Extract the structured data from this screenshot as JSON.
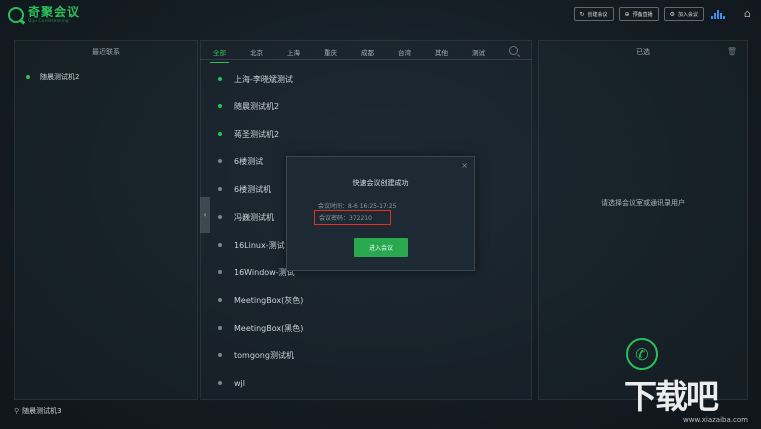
{
  "app": {
    "logo_title": "奇聚会议",
    "logo_subtitle": "Qiju Conferencing"
  },
  "toolbar": {
    "create_meeting": "创建会议",
    "schedule_live": "预备直播",
    "join_meeting": "加入会议"
  },
  "left_panel": {
    "title": "最近联系",
    "items": [
      {
        "name": "随晨测试机2",
        "status": "online"
      }
    ],
    "current_user": "随晨测试机3"
  },
  "middle_panel": {
    "tabs": [
      "全部",
      "北京",
      "上海",
      "重庆",
      "成都",
      "台湾",
      "其他",
      "测试"
    ],
    "active_tab": "全部",
    "contacts": [
      {
        "name": "上海-李晓斌测试",
        "status": "online"
      },
      {
        "name": "随晨测试机2",
        "status": "online"
      },
      {
        "name": "蒋圣测试机2",
        "status": "online"
      },
      {
        "name": "6楼测试",
        "status": "offline"
      },
      {
        "name": "6楼测试机",
        "status": "offline"
      },
      {
        "name": "冯巍测试机",
        "status": "offline"
      },
      {
        "name": "16Linux-测试",
        "status": "offline"
      },
      {
        "name": "16Window-测试",
        "status": "offline"
      },
      {
        "name": "MeetingBox(灰色)",
        "status": "offline"
      },
      {
        "name": "MeetingBox(黑色)",
        "status": "offline"
      },
      {
        "name": "tomgong测试机",
        "status": "offline"
      },
      {
        "name": "wjl",
        "status": "offline"
      }
    ]
  },
  "right_panel": {
    "title": "已选",
    "hint": "请选择会议室或通讯录用户"
  },
  "modal": {
    "title": "快速会议创建成功",
    "time": "会议时间：8-6 16:25-17:25",
    "password": "会议密码：372210",
    "enter_button": "进入会议",
    "close": "×"
  },
  "watermark": {
    "text": "下载吧",
    "url": "www.xiazaiba.com"
  },
  "colors": {
    "accent": "#2bbf5a",
    "highlight": "#e0301e",
    "background": "#141c23"
  }
}
